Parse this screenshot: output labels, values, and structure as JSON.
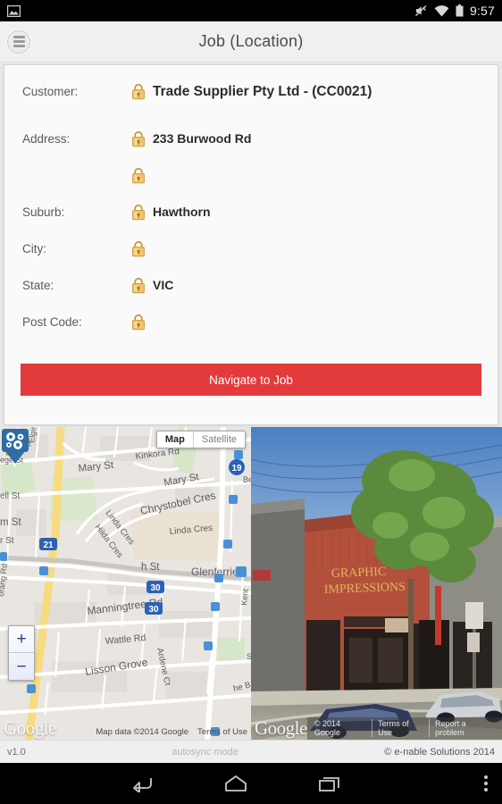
{
  "status_bar": {
    "clock": "9:57",
    "icons": [
      "image-notification-icon",
      "mute-icon",
      "wifi-icon",
      "battery-icon"
    ]
  },
  "title_bar": {
    "menu_icon": "hamburger-menu-icon",
    "title": "Job (Location)"
  },
  "form": {
    "lock_icon": "lock-icon",
    "rows": [
      {
        "label": "Customer:",
        "value": "Trade Supplier Pty Ltd - (CC0021)"
      },
      {
        "label": "Address:",
        "value": "233 Burwood Rd"
      },
      {
        "label": "",
        "value": ""
      },
      {
        "label": "Suburb:",
        "value": "Hawthorn"
      },
      {
        "label": "City:",
        "value": ""
      },
      {
        "label": "State:",
        "value": "VIC"
      },
      {
        "label": "Post Code:",
        "value": ""
      }
    ],
    "navigate_button": "Navigate to Job",
    "navigate_button_color": "#e33b3b"
  },
  "map": {
    "type_toggle": {
      "active": "Map",
      "inactive": "Satellite"
    },
    "pegman_icon": "pegman-streetview-icon",
    "marker_icon": "job-location-gear-marker-icon",
    "zoom_in": "+",
    "zoom_out": "−",
    "google_logo": "Google",
    "attribution": "Map data ©2014 Google",
    "terms": "Terms of Use",
    "street_labels": [
      "Kinkora Rd",
      "Mary St",
      "Mary St",
      "Chrystobel Cres",
      "Linda Cres",
      "Linda Cres",
      "Hilda Cres",
      "Elgin",
      "Sm",
      "St",
      "ege St",
      "ell St",
      "m St",
      "r St",
      "h St",
      "Glenferrie",
      "Manningtree Rd",
      "Wattle Rd",
      "Ardene Ct",
      "Lisson Grove",
      "orang Rd",
      "Kent",
      "he B",
      "Be",
      "S"
    ],
    "route_shields": [
      "19",
      "21",
      "30",
      "30"
    ]
  },
  "street_view": {
    "shop_sign_line1": "GRAPHIC",
    "shop_sign_line2": "IMPRESSIONS",
    "google_logo": "Google",
    "copyright": "© 2014 Google",
    "terms": "Terms of Use",
    "report": "Report a problem"
  },
  "footer": {
    "version": "v1.0",
    "sync_mode": "autosync mode",
    "copyright": "© e-nable Solutions 2014"
  },
  "nav_bar": {
    "back": "back-icon",
    "home": "home-icon",
    "recents": "recents-icon",
    "overflow": "overflow-menu-icon"
  }
}
